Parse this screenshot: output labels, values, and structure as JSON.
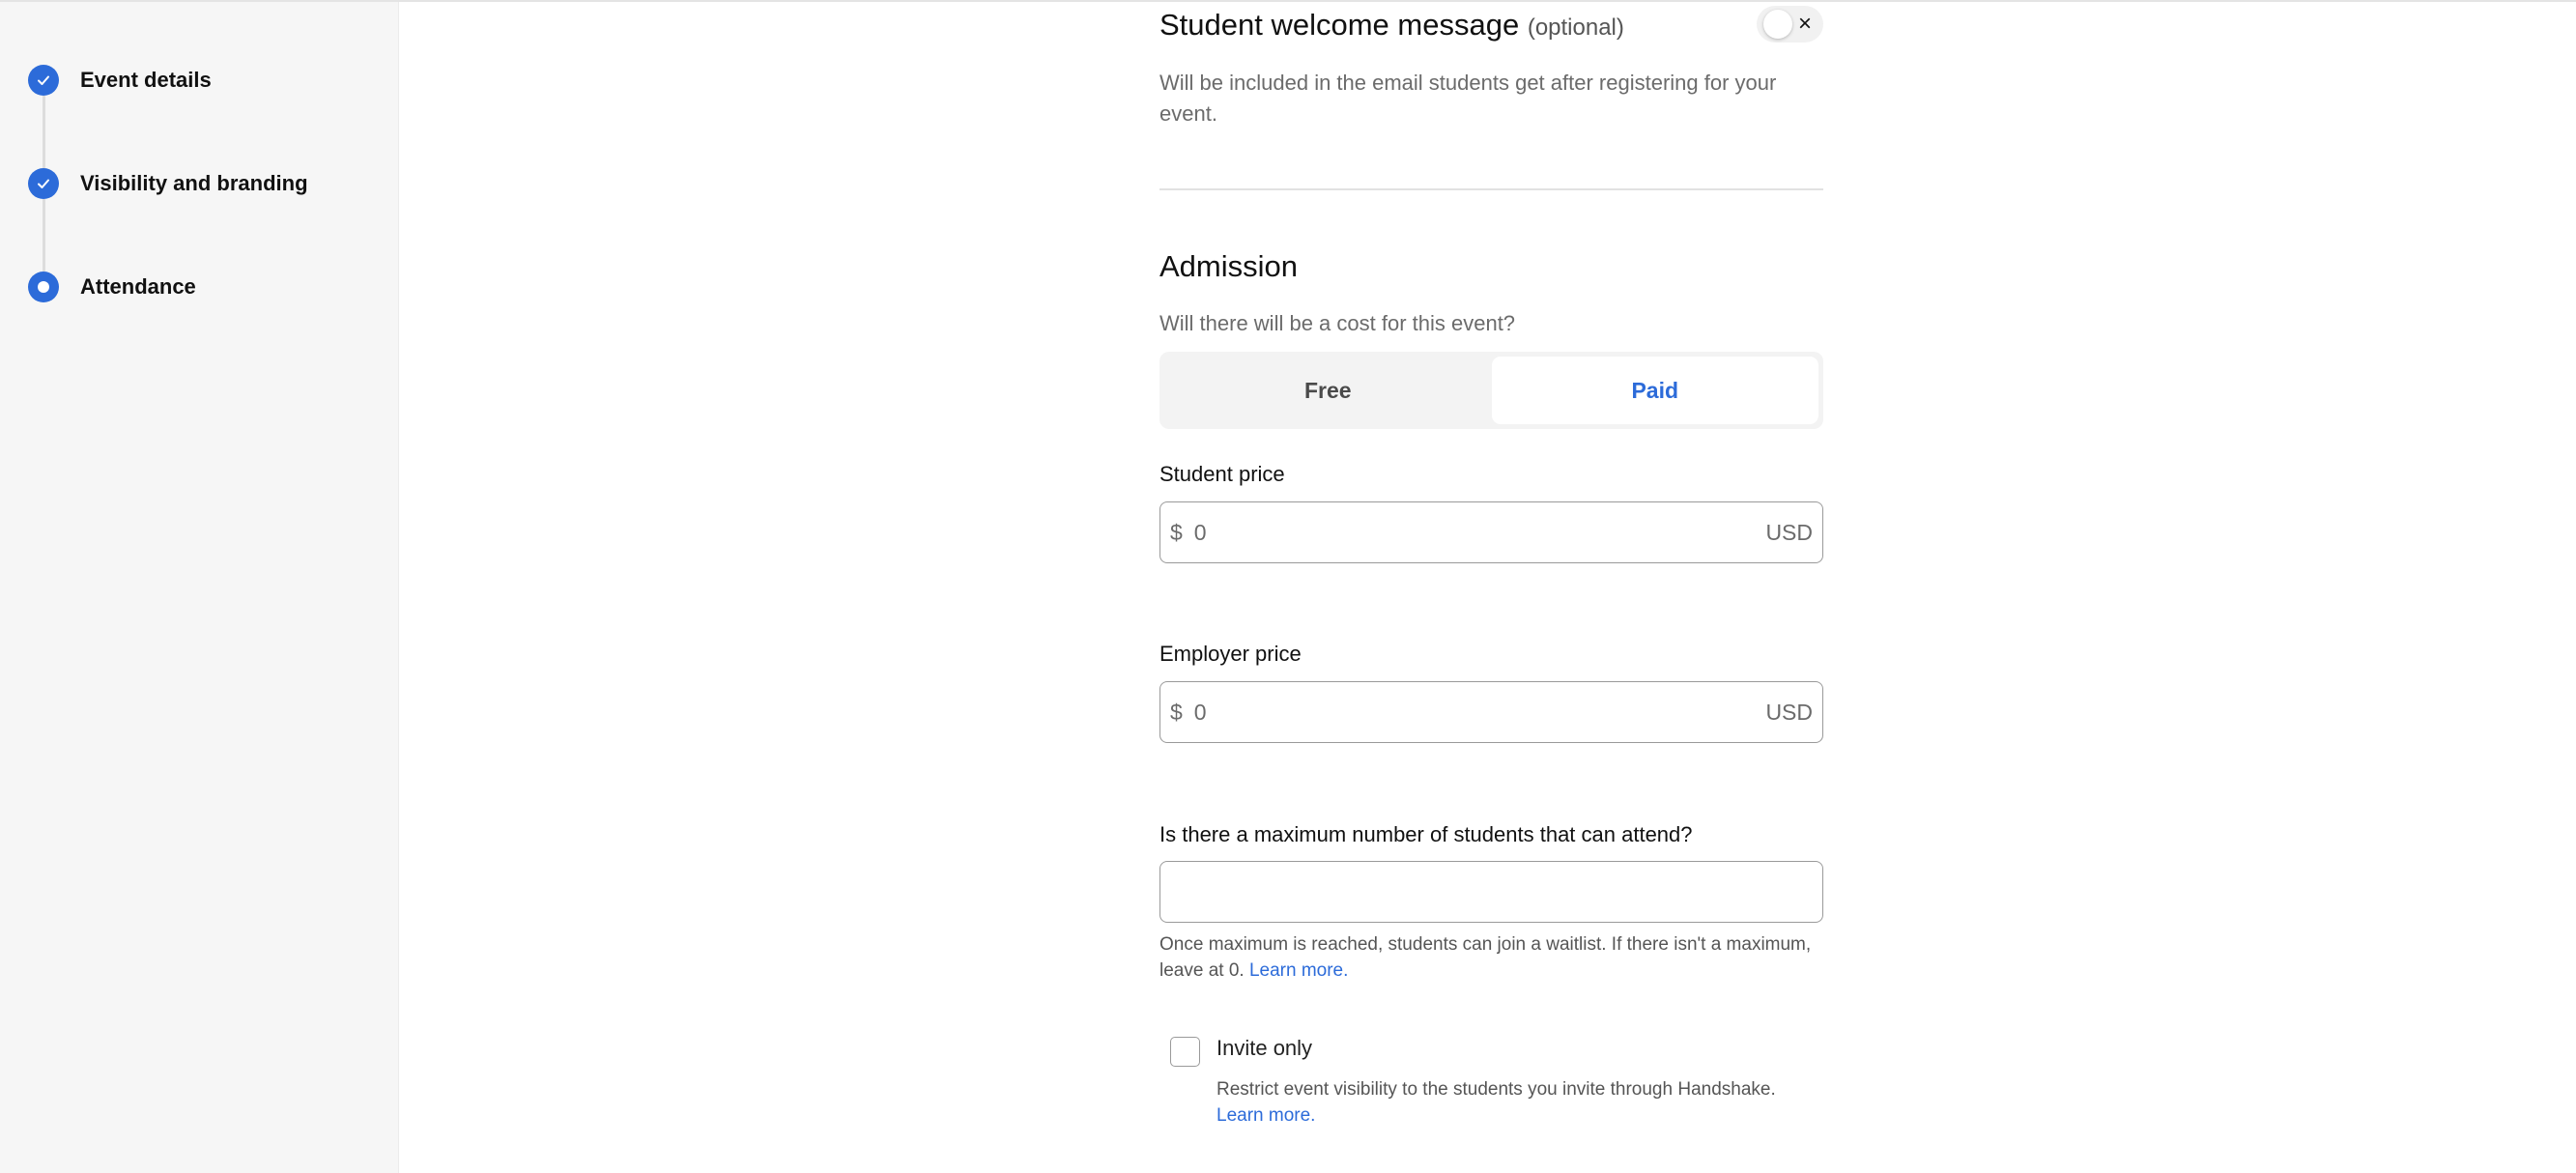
{
  "colors": {
    "accent": "#2c6bd9",
    "sidebar_bg": "#f6f6f6"
  },
  "sidebar": {
    "steps": [
      {
        "label": "Event details",
        "status": "completed",
        "icon": "check-icon"
      },
      {
        "label": "Visibility and branding",
        "status": "completed",
        "icon": "check-icon"
      },
      {
        "label": "Attendance",
        "status": "current",
        "icon": "current-step-dot-icon"
      }
    ]
  },
  "welcome": {
    "title": "Student welcome message",
    "optional": "(optional)",
    "toggle_on": false,
    "toggle_icon": "×",
    "description": "Will be included in the email students get after registering for your event."
  },
  "admission": {
    "title": "Admission",
    "question": "Will there will be a cost for this event?",
    "options": [
      "Free",
      "Paid"
    ],
    "selected": "Paid",
    "student_price": {
      "label": "Student price",
      "currency_symbol": "$",
      "value": "0",
      "currency": "USD"
    },
    "employer_price": {
      "label": "Employer price",
      "currency_symbol": "$",
      "value": "0",
      "currency": "USD"
    }
  },
  "max_attendance": {
    "label": "Is there a maximum number of students that can attend?",
    "value": "",
    "help": "Once maximum is reached, students can join a waitlist. If there isn't a maximum, leave at 0.",
    "link": "Learn more."
  },
  "invite_only": {
    "label": "Invite only",
    "checked": false,
    "description": "Restrict event visibility to the students you invite through Handshake.",
    "link": "Learn more."
  }
}
